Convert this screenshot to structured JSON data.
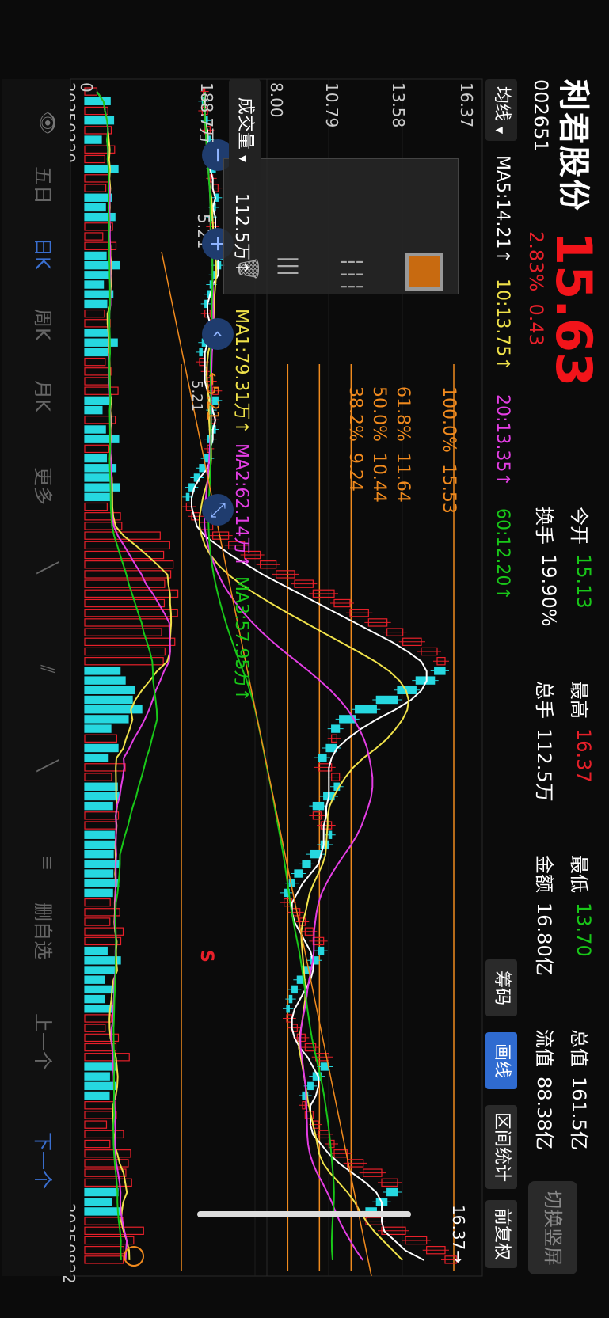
{
  "header": {
    "name": "利君股份",
    "code": "002651",
    "price": "15.63",
    "change_pct": "2.83%",
    "change_amt": "0.43",
    "switch_label": "切换竖屏"
  },
  "quote": [
    {
      "label": "今开",
      "value": "15.13",
      "color": "#19c819"
    },
    {
      "label": "最高",
      "value": "16.37",
      "color": "#e8202a"
    },
    {
      "label": "最低",
      "value": "13.70",
      "color": "#19c819"
    },
    {
      "label": "总值",
      "value": "161.5亿",
      "color": "#ffffff"
    },
    {
      "label": "换手",
      "value": "19.90%",
      "color": "#ffffff"
    },
    {
      "label": "总手",
      "value": "112.5万",
      "color": "#ffffff"
    },
    {
      "label": "金额",
      "value": "16.80亿",
      "color": "#ffffff"
    },
    {
      "label": "流值",
      "value": "88.38亿",
      "color": "#ffffff"
    }
  ],
  "ma_bar": {
    "selector": "均线",
    "ma5": "MA5:14.21↑",
    "ma10": "10:13.75↑",
    "ma20": "20:13.35↑",
    "ma60": "60:12.20↑"
  },
  "chart_tabs": [
    "筹码",
    "画线",
    "区间统计",
    "前复权"
  ],
  "price_axis": [
    "16.37",
    "13.58",
    "10.79",
    "8.00",
    "5.21"
  ],
  "fib": [
    {
      "pct": "100.0%",
      "price": "15.53"
    },
    {
      "pct": "61.8%",
      "price": "11.64"
    },
    {
      "pct": "50.0%",
      "price": "10.44"
    },
    {
      "pct": "38.2%",
      "price": "9.24"
    }
  ],
  "annotations": {
    "high_marker": "16.37→",
    "low_marker": "←5.21",
    "overlay_low": "5.21",
    "signal": "S"
  },
  "volume": {
    "selector": "成交量",
    "value": "112.5万↑",
    "ma1": "MA1:79.31万↑",
    "ma2": "MA2:62.14万↑",
    "ma3": "MA3:57.95万↑",
    "axis_top": "188.7万",
    "axis_bottom": "0"
  },
  "dates": {
    "start": "20250220",
    "end": "20250822"
  },
  "toolbar": [
    "五日",
    "日K",
    "周K",
    "月K",
    "更多",
    "删自选",
    "上一个",
    "下一个"
  ],
  "colors": {
    "up": "#e8202a",
    "down": "#26d8e0",
    "ma5": "#ffffff",
    "ma10": "#f0e24a",
    "ma20": "#e43ee4",
    "ma60": "#19c819",
    "fib": "#f08a1e",
    "active": "#2f6bd0"
  },
  "chart_data": {
    "type": "candlestick",
    "price_range": [
      5.21,
      16.37
    ],
    "closes": [
      6.1,
      6.0,
      6.2,
      6.1,
      6.3,
      6.2,
      6.4,
      6.5,
      6.3,
      6.4,
      6.6,
      6.5,
      6.4,
      6.3,
      6.5,
      6.6,
      6.8,
      6.7,
      6.5,
      6.4,
      6.3,
      6.2,
      6.1,
      6.3,
      6.4,
      6.2,
      6.0,
      5.9,
      6.1,
      6.2,
      6.4,
      6.6,
      6.4,
      6.3,
      6.5,
      6.4,
      6.2,
      6.3,
      6.1,
      5.9,
      5.7,
      5.5,
      5.4,
      5.6,
      5.9,
      6.4,
      7.0,
      7.6,
      8.2,
      8.8,
      9.5,
      10.2,
      11.0,
      11.6,
      12.3,
      13.0,
      13.6,
      14.3,
      14.9,
      15.2,
      14.8,
      14.1,
      13.4,
      12.6,
      11.8,
      11.2,
      10.9,
      11.1,
      10.7,
      10.4,
      10.9,
      11.2,
      11.0,
      10.6,
      10.2,
      10.5,
      10.9,
      10.8,
      10.5,
      10.1,
      9.8,
      9.5,
      9.3,
      9.1,
      9.4,
      9.7,
      9.9,
      10.2,
      10.6,
      10.4,
      10.1,
      9.8,
      9.6,
      9.4,
      9.3,
      9.2,
      9.4,
      9.6,
      9.9,
      10.3,
      10.8,
      10.5,
      10.2,
      10.0,
      9.8,
      9.9,
      10.2,
      10.4,
      10.8,
      11.0,
      11.5,
      12.1,
      12.8,
      13.4,
      13.0,
      12.6,
      12.2,
      12.8,
      13.7,
      14.5,
      15.2,
      15.63
    ],
    "ma5": [
      6.1,
      6.1,
      6.1,
      6.1,
      6.2,
      6.2,
      6.2,
      6.3,
      6.3,
      6.4,
      6.4,
      6.5,
      6.4,
      6.5,
      6.5,
      6.5,
      6.5,
      6.6,
      6.6,
      6.6,
      6.4,
      6.3,
      6.2,
      6.2,
      6.3,
      6.2,
      6.2,
      6.1,
      6.1,
      6.1,
      6.1,
      6.2,
      6.3,
      6.4,
      6.5,
      6.4,
      6.4,
      6.3,
      6.3,
      6.2,
      5.9,
      5.7,
      5.6,
      5.6,
      5.7,
      5.8,
      6.1,
      6.6,
      7.1,
      7.7,
      8.3,
      9.0,
      9.7,
      10.4,
      11.1,
      11.8,
      12.5,
      13.2,
      13.8,
      14.3,
      14.5,
      14.5,
      14.3,
      13.9,
      13.3,
      12.6,
      12.0,
      11.5,
      11.1,
      10.9,
      10.8,
      10.8,
      10.8,
      10.8,
      10.7,
      10.7,
      10.6,
      10.6,
      10.6,
      10.5,
      10.4,
      10.1,
      9.8,
      9.6,
      9.4,
      9.4,
      9.5,
      9.7,
      9.9,
      10.1,
      10.2,
      10.2,
      10.1,
      9.9,
      9.7,
      9.5,
      9.4,
      9.4,
      9.5,
      9.7,
      10.0,
      10.2,
      10.4,
      10.4,
      10.3,
      10.1,
      10.1,
      10.1,
      10.2,
      10.5,
      10.8,
      11.2,
      11.7,
      12.2,
      12.6,
      12.8,
      12.8,
      12.8,
      12.9,
      13.3,
      13.7,
      14.4
    ],
    "volume_range": [
      0,
      188.7
    ],
    "volume_unit": "万"
  }
}
